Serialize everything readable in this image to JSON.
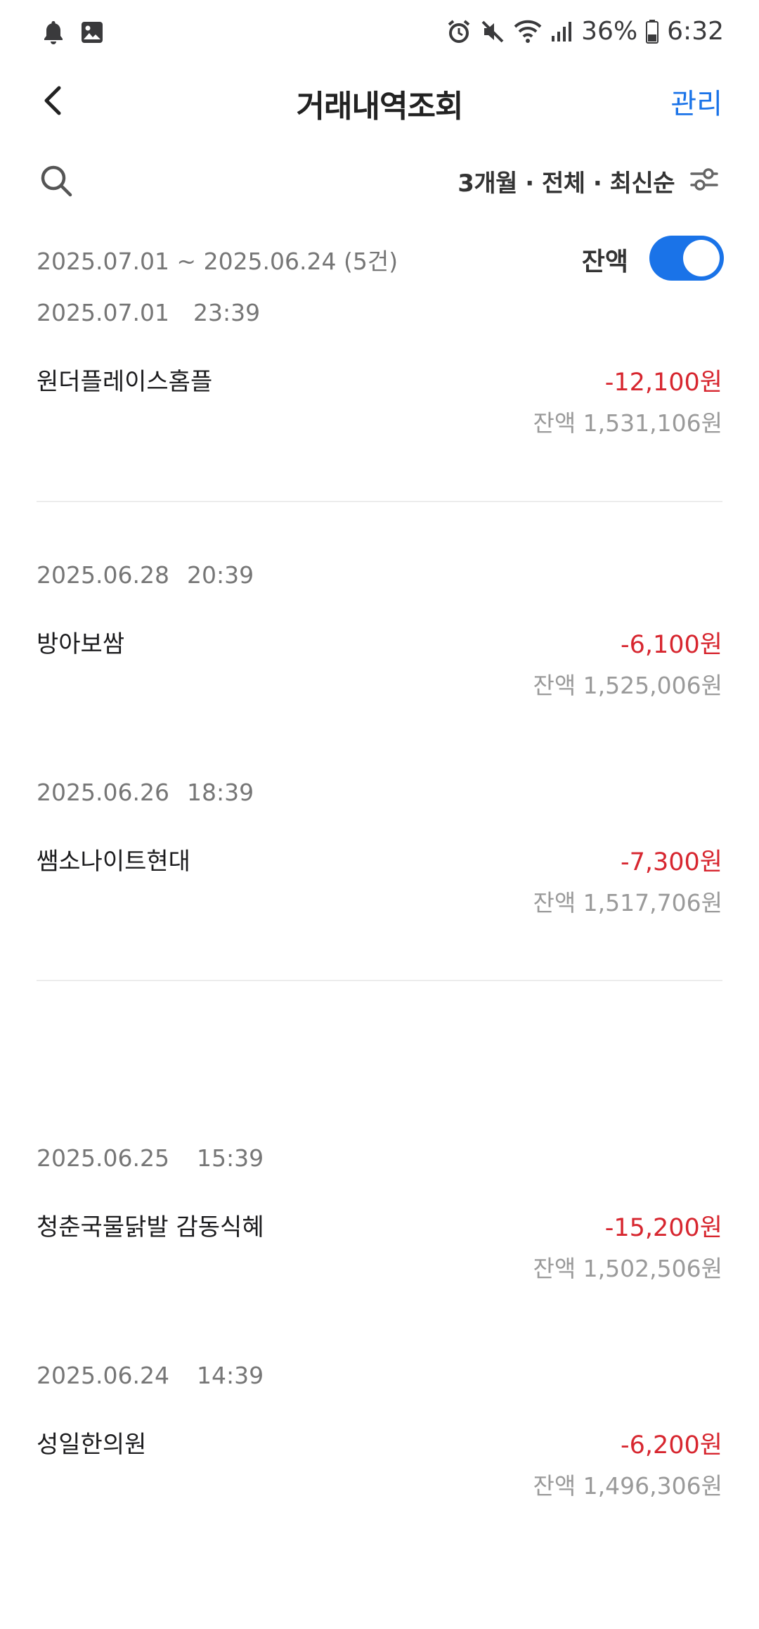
{
  "status_bar": {
    "battery": "36%",
    "time": "6:32",
    "left_icons": [
      "notification-bell-icon",
      "gallery-icon"
    ],
    "right_icons": [
      "alarm-icon",
      "mute-icon",
      "wifi-icon",
      "signal-icon",
      "battery-icon"
    ]
  },
  "header": {
    "title": "거래내역조회",
    "manage_label": "관리"
  },
  "filter": {
    "summary": "3개월 · 전체 · 최신순"
  },
  "range": {
    "text": "2025.07.01 ~ 2025.06.24 (5건)",
    "balance_label": "잔액",
    "balance_toggle_on": true
  },
  "transactions": [
    {
      "date": "2025.07.01",
      "time": "23:39",
      "merchant": "원더플레이스홈플",
      "amount": "-12,100원",
      "balance": "잔액 1,531,106원"
    },
    {
      "date": "2025.06.28",
      "time": "20:39",
      "merchant": "방아보쌈",
      "amount": "-6,100원",
      "balance": "잔액 1,525,006원"
    },
    {
      "date": "2025.06.26",
      "time": "18:39",
      "merchant": "쌤소나이트현대",
      "amount": "-7,300원",
      "balance": "잔액 1,517,706원"
    },
    {
      "date": "2025.06.25",
      "time": "15:39",
      "merchant": "청춘국물닭발 감동식혜",
      "amount": "-15,200원",
      "balance": "잔액 1,502,506원"
    },
    {
      "date": "2025.06.24",
      "time": "14:39",
      "merchant": "성일한의원",
      "amount": "-6,200원",
      "balance": "잔액 1,496,306원"
    }
  ],
  "colors": {
    "accent": "#1a73e8",
    "debit": "#d7262f",
    "muted": "#767676"
  }
}
